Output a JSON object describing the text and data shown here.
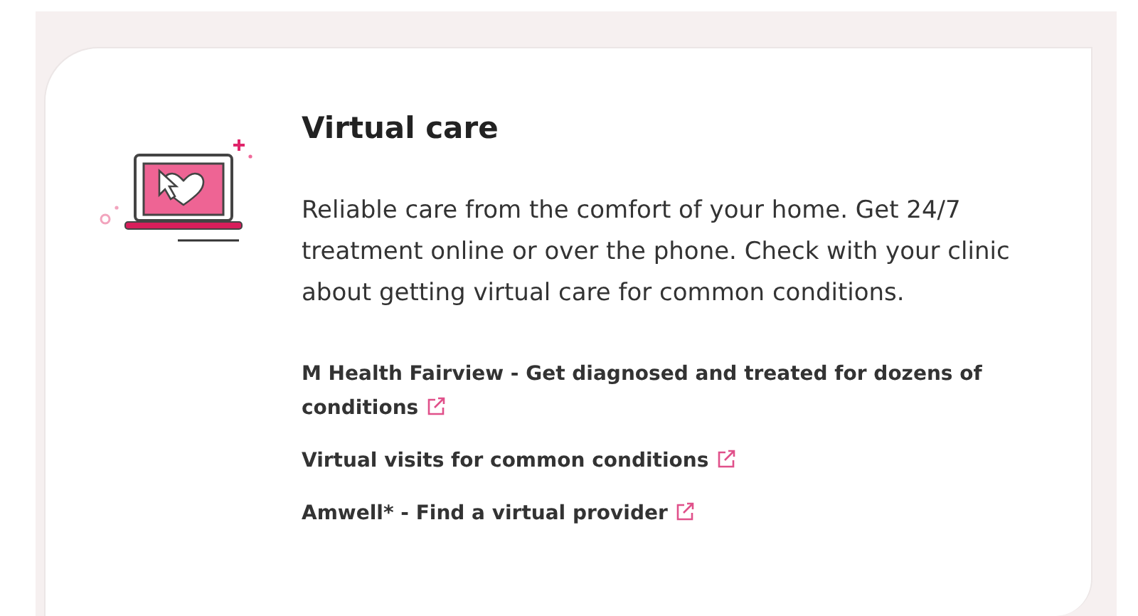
{
  "card": {
    "title": "Virtual care",
    "description": "Reliable care from the comfort of your home. Get 24/7 treatment online or over the phone. Check with your clinic about getting virtual care for common conditions.",
    "links": [
      {
        "label": "M Health Fairview - Get diagnosed and treated for dozens of conditions",
        "external": true
      },
      {
        "label": "Virtual visits for common conditions",
        "external": true
      },
      {
        "label": "Amwell* - Find a virtual provider",
        "external": true
      }
    ]
  }
}
